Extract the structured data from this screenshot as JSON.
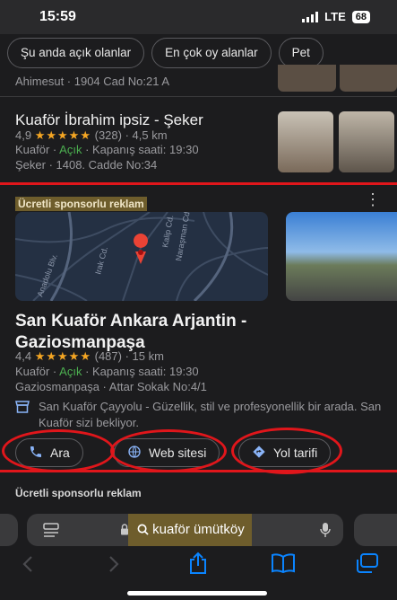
{
  "status_bar": {
    "time": "15:59",
    "network": "LTE",
    "battery": "68"
  },
  "filter_chips": [
    "Şu anda açık olanlar",
    "En çok oy alanlar",
    "Pet"
  ],
  "previous_result": {
    "address": "Ahimesut · 1904 Cad No:21 A"
  },
  "result_1": {
    "title": "Kuaför İbrahim ipsiz - Şeker",
    "rating": "4,9",
    "stars": "★★★★★",
    "reviews": "(328)",
    "distance": "· 4,5 km",
    "category": "Kuaför",
    "open_status": "Açık",
    "closing": "Kapanış saati: 19:30",
    "address": "Şeker · 1408. Cadde No:34"
  },
  "sponsored_label": "Ücretli sponsorlu reklam",
  "sponsored_label_2": "Ücretli sponsorlu reklam",
  "map_labels": {
    "street_1": "Kalip Cd.",
    "street_2": "Naraşman Cd.",
    "street_3": "Irak Cd.",
    "street_4": "Anadolu Blv."
  },
  "ad": {
    "title": "San Kuaför Ankara Arjantin - Gaziosmanpaşa",
    "rating": "4,4",
    "stars": "★★★★★",
    "reviews": "(487)",
    "distance": "· 15 km",
    "category": "Kuaför",
    "open_status": "Açık",
    "closing": "Kapanış saati: 19:30",
    "address": "Gaziosmanpaşa · Attar Sokak No:4/1",
    "description": "San Kuaför Çayyolu - Güzellik, stil ve profesyonellik bir arada. San Kuaför sizi bekliyor.",
    "buttons": {
      "call": "Ara",
      "website": "Web sitesi",
      "directions": "Yol tarifi"
    }
  },
  "url_bar": {
    "query": "kuaför ümütköy"
  },
  "colors": {
    "highlight_red": "#e0161b",
    "star": "#f5a623",
    "open_green": "#4caf50",
    "ios_blue": "#0a84ff"
  }
}
